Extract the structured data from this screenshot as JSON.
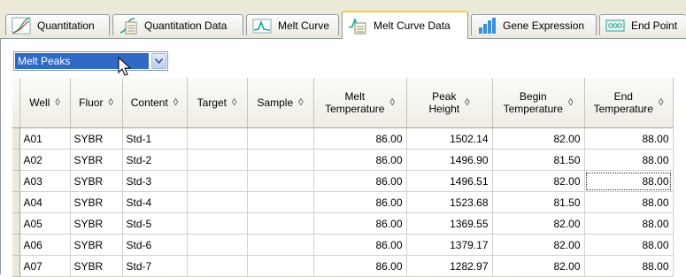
{
  "tabs": [
    {
      "label": "Quantitation",
      "icon": "quantitation-chart-icon"
    },
    {
      "label": "Quantitation Data",
      "icon": "quantitation-data-icon"
    },
    {
      "label": "Melt Curve",
      "icon": "melt-curve-icon"
    },
    {
      "label": "Melt Curve Data",
      "icon": "melt-curve-data-icon",
      "active": true
    },
    {
      "label": "Gene Expression",
      "icon": "gene-expression-bar-icon"
    },
    {
      "label": "End Point",
      "icon": "end-point-icon"
    }
  ],
  "dropdown": {
    "value": "Melt Peaks"
  },
  "table": {
    "headers": [
      {
        "line1": "Well",
        "line2": ""
      },
      {
        "line1": "Fluor",
        "line2": ""
      },
      {
        "line1": "Content",
        "line2": ""
      },
      {
        "line1": "Target",
        "line2": ""
      },
      {
        "line1": "Sample",
        "line2": ""
      },
      {
        "line1": "Melt",
        "line2": "Temperature"
      },
      {
        "line1": "Peak",
        "line2": "Height"
      },
      {
        "line1": "Begin",
        "line2": "Temperature"
      },
      {
        "line1": "End",
        "line2": "Temperature"
      }
    ],
    "sort_glyph": "◊",
    "rows": [
      [
        "A01",
        "SYBR",
        "Std-1",
        "",
        "",
        "86.00",
        "1502.14",
        "82.00",
        "88.00"
      ],
      [
        "A02",
        "SYBR",
        "Std-2",
        "",
        "",
        "86.00",
        "1496.90",
        "81.50",
        "88.00"
      ],
      [
        "A03",
        "SYBR",
        "Std-3",
        "",
        "",
        "86.00",
        "1496.51",
        "82.00",
        "88.00"
      ],
      [
        "A04",
        "SYBR",
        "Std-4",
        "",
        "",
        "86.00",
        "1523.68",
        "81.50",
        "88.00"
      ],
      [
        "A05",
        "SYBR",
        "Std-5",
        "",
        "",
        "86.00",
        "1369.55",
        "82.00",
        "88.00"
      ],
      [
        "A06",
        "SYBR",
        "Std-6",
        "",
        "",
        "86.00",
        "1379.17",
        "82.00",
        "88.00"
      ],
      [
        "A07",
        "SYBR",
        "Std-7",
        "",
        "",
        "86.00",
        "1282.97",
        "82.00",
        "88.00"
      ]
    ]
  },
  "colors": {
    "tab_active_accent": "#ffc83c",
    "selection": "#316ac5",
    "chrome": "#ece9d8"
  }
}
